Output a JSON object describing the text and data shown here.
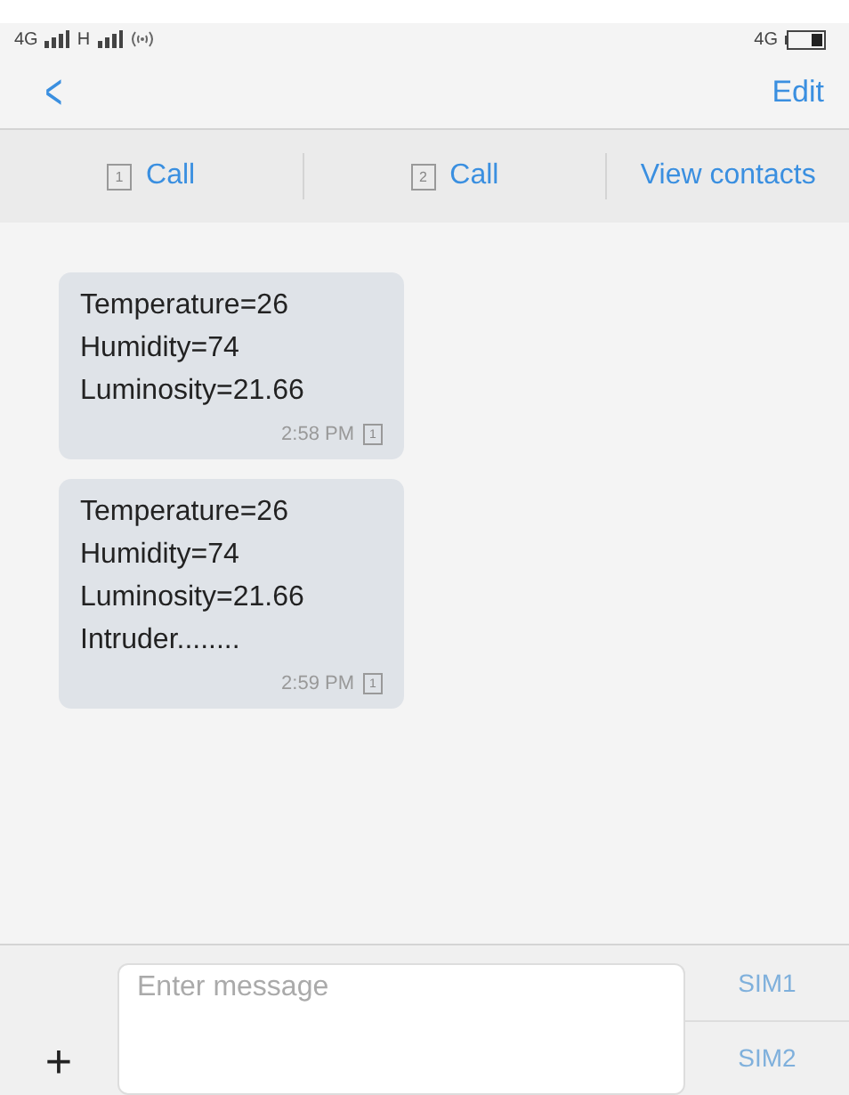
{
  "status_bar": {
    "network_1": "4G",
    "network_2": "H",
    "network_right": "4G"
  },
  "nav": {
    "back": "<",
    "edit": "Edit"
  },
  "actions": [
    {
      "sim": "1",
      "label": "Call"
    },
    {
      "sim": "2",
      "label": "Call"
    },
    {
      "label": "View contacts"
    }
  ],
  "messages": [
    {
      "lines": [
        "Temperature=26",
        "Humidity=74",
        "Luminosity=21.66"
      ],
      "time": "2:58 PM",
      "sim": "1"
    },
    {
      "lines": [
        "Temperature=26",
        "Humidity=74",
        "Luminosity=21.66",
        "Intruder........"
      ],
      "time": "2:59 PM",
      "sim": "1"
    }
  ],
  "composer": {
    "add": "+",
    "placeholder": "Enter message",
    "sims": [
      {
        "label": "SIM1",
        "disabled": true
      },
      {
        "label": "SIM2",
        "disabled": true
      }
    ]
  }
}
